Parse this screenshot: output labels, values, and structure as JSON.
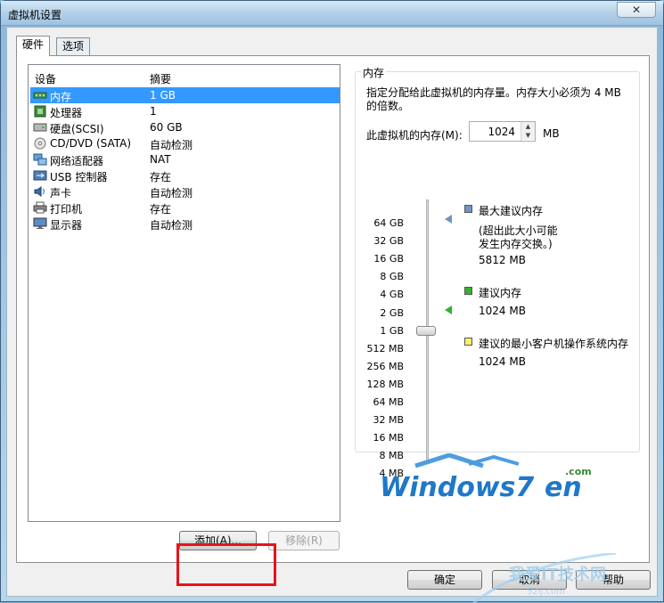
{
  "window": {
    "title": "虚拟机设置",
    "close_glyph": "✕"
  },
  "tabs": [
    {
      "label": "硬件"
    },
    {
      "label": "选项"
    }
  ],
  "device_list": {
    "headers": {
      "device": "设备",
      "summary": "摘要"
    },
    "rows": [
      {
        "name": "内存",
        "summary": "1 GB",
        "icon": "memory-icon"
      },
      {
        "name": "处理器",
        "summary": "1",
        "icon": "processor-icon"
      },
      {
        "name": "硬盘(SCSI)",
        "summary": "60 GB",
        "icon": "hard-disk-icon"
      },
      {
        "name": "CD/DVD (SATA)",
        "summary": "自动检测",
        "icon": "cd-dvd-icon"
      },
      {
        "name": "网络适配器",
        "summary": "NAT",
        "icon": "network-adapter-icon"
      },
      {
        "name": "USB 控制器",
        "summary": "存在",
        "icon": "usb-icon"
      },
      {
        "name": "声卡",
        "summary": "自动检测",
        "icon": "sound-card-icon"
      },
      {
        "name": "打印机",
        "summary": "存在",
        "icon": "printer-icon"
      },
      {
        "name": "显示器",
        "summary": "自动检测",
        "icon": "display-icon"
      }
    ],
    "selected_index": 0
  },
  "buttons": {
    "add": "添加(A)...",
    "remove": "移除(R)",
    "ok": "确定",
    "cancel": "取消",
    "help": "帮助"
  },
  "memory": {
    "group_title": "内存",
    "description": "指定分配给此虚拟机的内存量。内存大小必须为 4 MB 的倍数。",
    "field_label": "此虚拟机的内存(M):",
    "value": "1024",
    "unit": "MB",
    "scale": [
      "64 GB",
      "32 GB",
      "16 GB",
      "8 GB",
      "4 GB",
      "2 GB",
      "1 GB",
      "512 MB",
      "256 MB",
      "128 MB",
      "64 MB",
      "32 MB",
      "16 MB",
      "8 MB",
      "4 MB"
    ],
    "current_scale_index": 6,
    "legend": {
      "max_title": "最大建议内存",
      "max_note_line1": "(超出此大小可能",
      "max_note_line2": "发生内存交换。)",
      "max_value": "5812 MB",
      "recommended_title": "建议内存",
      "recommended_value": "1024 MB",
      "min_title": "建议的最小客户机操作系统内存",
      "min_value": "1024 MB"
    },
    "colors": {
      "max": "#6f94c8",
      "recommended": "#2fb52f",
      "min": "#f5f06a"
    }
  },
  "logo": {
    "text_main": "Windows7",
    "text_en": "en",
    "text_com": ".com"
  },
  "watermark": {
    "text": "我爱IT技术网",
    "sub": "52ij.com"
  }
}
